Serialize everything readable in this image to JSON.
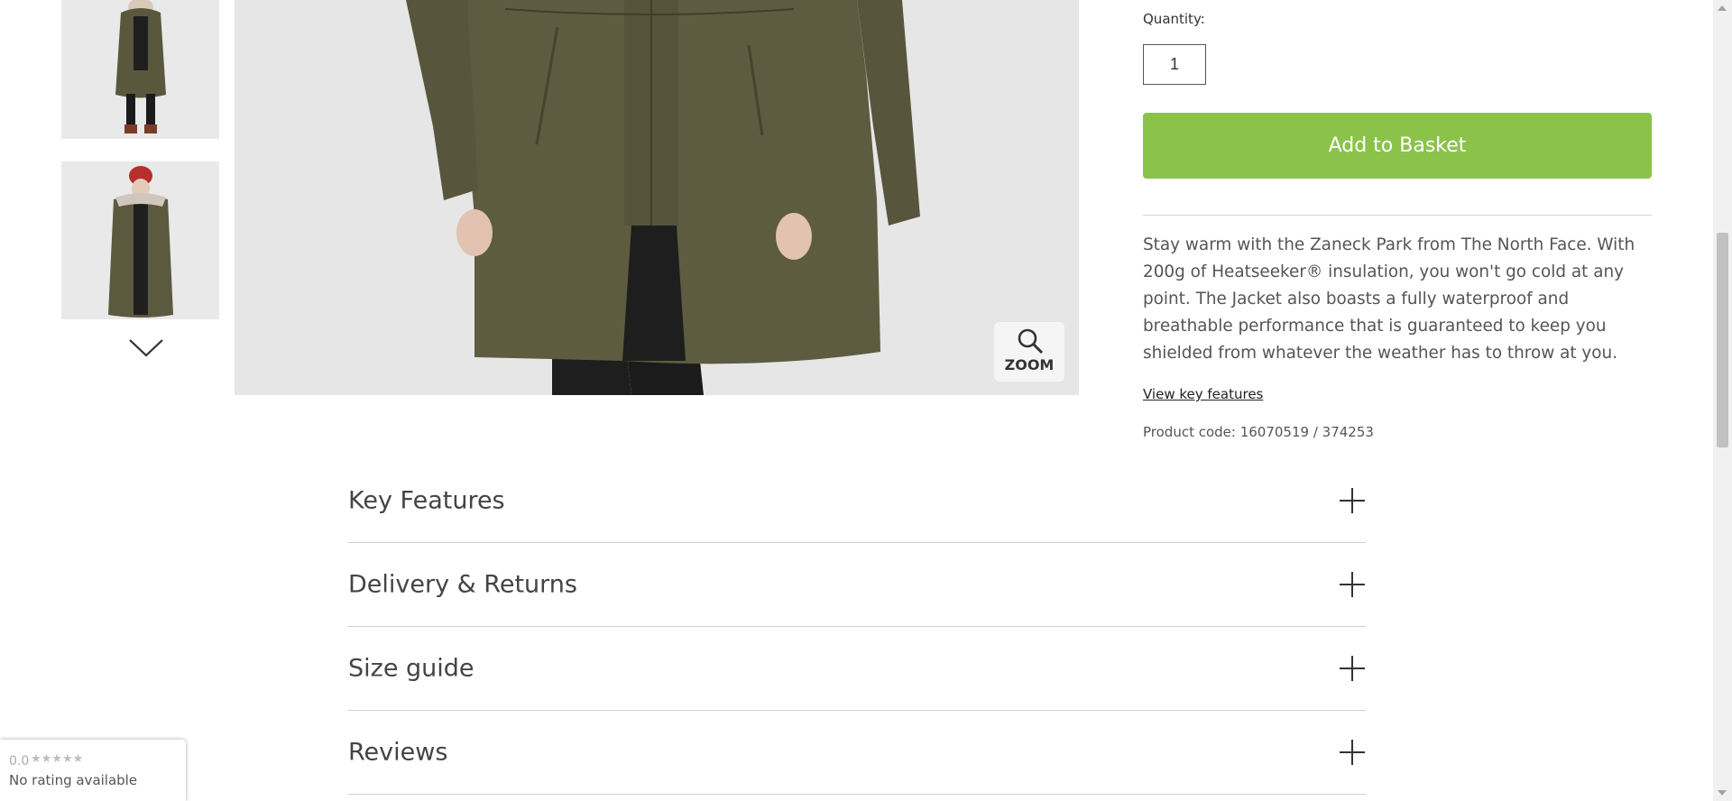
{
  "gallery": {
    "thumbnails": [
      {
        "alt": "Product thumbnail 1"
      },
      {
        "alt": "Product thumbnail 2"
      }
    ],
    "zoom_label": "ZOOM"
  },
  "purchase": {
    "quantity_label": "Quantity:",
    "quantity_value": "1",
    "add_to_basket_label": "Add to Basket",
    "accent_color": "#8bc34a"
  },
  "description": {
    "text": "Stay warm with the Zaneck Park from The North Face. With 200g of Heatseeker® insulation, you won't go cold at any point. The Jacket also boasts a fully waterproof and breathable performance that is guaranteed to keep you shielded from whatever the weather has to throw at you.",
    "view_key_features_link": "View key features",
    "product_code": "Product code: 16070519 / 374253"
  },
  "accordion": {
    "items": [
      {
        "label": "Key Features"
      },
      {
        "label": "Delivery & Returns"
      },
      {
        "label": "Size guide"
      },
      {
        "label": "Reviews"
      }
    ]
  },
  "rating_widget": {
    "score": "0.0",
    "stars": "★★★★★",
    "text": "No rating available"
  }
}
